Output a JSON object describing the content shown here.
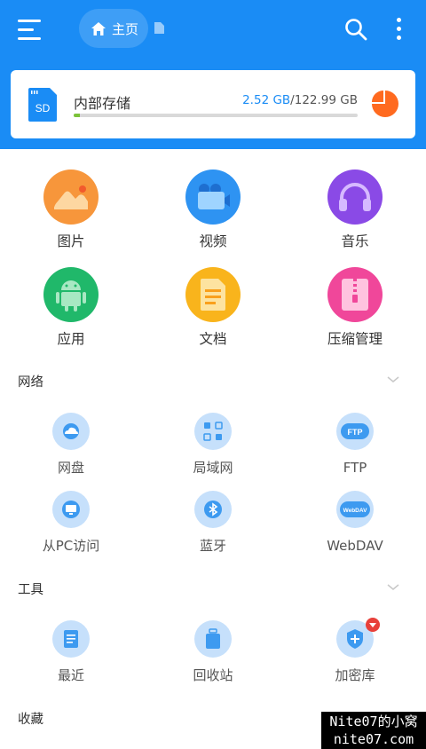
{
  "header": {
    "menu_icon": "hamburger-menu-icon",
    "home_icon": "home-icon",
    "home_label": "主页",
    "file_icon": "file-icon",
    "search_icon": "search-icon",
    "more_icon": "more-vertical-icon",
    "bar_color": "#1a8cf5"
  },
  "storage": {
    "icon": "sd-card-icon",
    "sd_label": "SD",
    "name": "内部存储",
    "used": "2.52 GB",
    "separator": "/",
    "total": "122.99 GB",
    "usage_fraction": 0.0205,
    "bar_color": "#7cc339",
    "pie_color": "#ff6a1f"
  },
  "categories": [
    {
      "label": "图片",
      "icon": "image-icon",
      "color": "#f7963b"
    },
    {
      "label": "视频",
      "icon": "video-icon",
      "color": "#2e93f2"
    },
    {
      "label": "音乐",
      "icon": "headphones-icon",
      "color": "#8a4ae6"
    },
    {
      "label": "应用",
      "icon": "android-icon",
      "color": "#20b86a"
    },
    {
      "label": "文档",
      "icon": "document-icon",
      "color": "#f9b41c"
    },
    {
      "label": "压缩管理",
      "icon": "archive-icon",
      "color": "#f0479a"
    }
  ],
  "sections": {
    "network": {
      "title": "网络",
      "items": [
        {
          "label": "网盘",
          "icon": "cloud-drive-icon"
        },
        {
          "label": "局域网",
          "icon": "lan-icon"
        },
        {
          "label": "FTP",
          "icon": "ftp-icon",
          "badge": "FTP"
        },
        {
          "label": "从PC访问",
          "icon": "pc-access-icon"
        },
        {
          "label": "蓝牙",
          "icon": "bluetooth-icon"
        },
        {
          "label": "WebDAV",
          "icon": "webdav-icon",
          "badge": "WebDAV"
        }
      ]
    },
    "tools": {
      "title": "工具",
      "items": [
        {
          "label": "最近",
          "icon": "recent-icon"
        },
        {
          "label": "回收站",
          "icon": "recycle-bin-icon"
        },
        {
          "label": "加密库",
          "icon": "encrypted-vault-icon"
        }
      ]
    },
    "favorites": {
      "title": "收藏"
    }
  },
  "watermark": {
    "line1": "Nite07的小窝",
    "line2": "nite07.com"
  }
}
